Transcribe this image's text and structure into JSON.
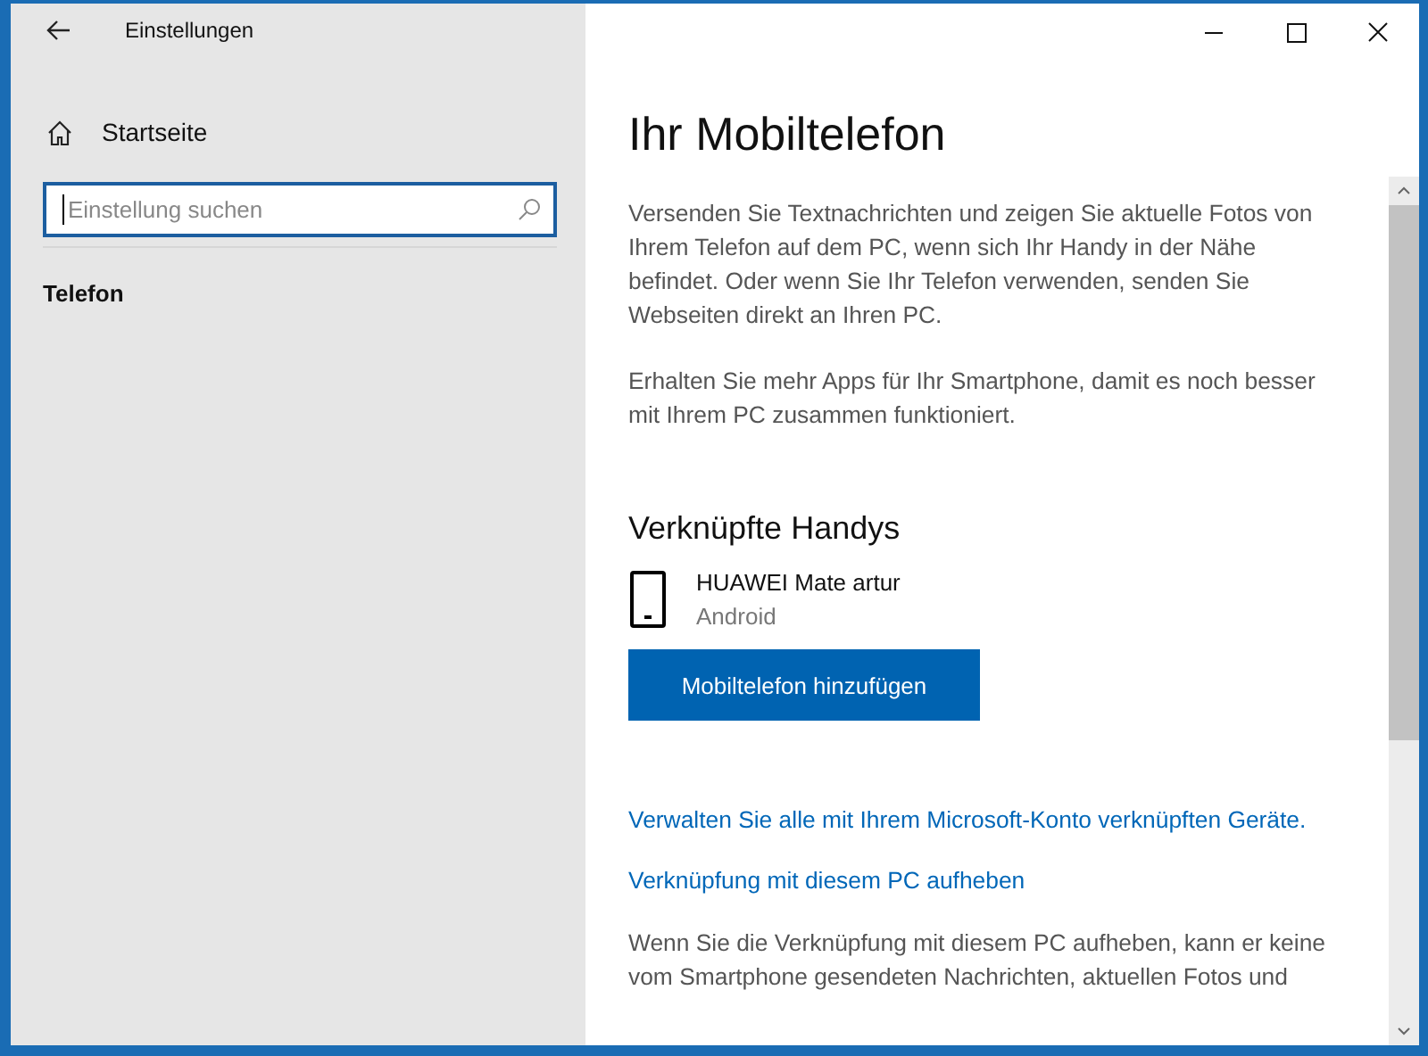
{
  "window": {
    "title": "Einstellungen"
  },
  "sidebar": {
    "home": "Startseite",
    "search": {
      "placeholder": "Einstellung suchen"
    },
    "section": "Telefon"
  },
  "page": {
    "title": "Ihr Mobiltelefon",
    "paragraphs": [
      "Versenden Sie Textnachrichten und zeigen Sie aktuelle Fotos von Ihrem Telefon auf dem PC, wenn sich Ihr Handy in der Nähe befindet. Oder wenn Sie Ihr Telefon verwenden, senden Sie Webseiten direkt an Ihren PC.",
      "Erhalten Sie mehr Apps für Ihr Smartphone, damit es noch besser mit Ihrem PC zusammen funktioniert."
    ],
    "linked_heading": "Verknüpfte Handys",
    "devices": [
      {
        "name": "HUAWEI Mate artur",
        "os": "Android"
      }
    ],
    "add_button": "Mobiltelefon hinzufügen",
    "links": [
      "Verwalten Sie alle mit Ihrem Microsoft-Konto verknüpften Geräte.",
      "Verknüpfung mit diesem PC aufheben"
    ],
    "footer_text": "Wenn Sie die Verknüpfung mit diesem PC aufheben, kann er keine vom Smartphone gesendeten Nachrichten, aktuellen Fotos und"
  }
}
